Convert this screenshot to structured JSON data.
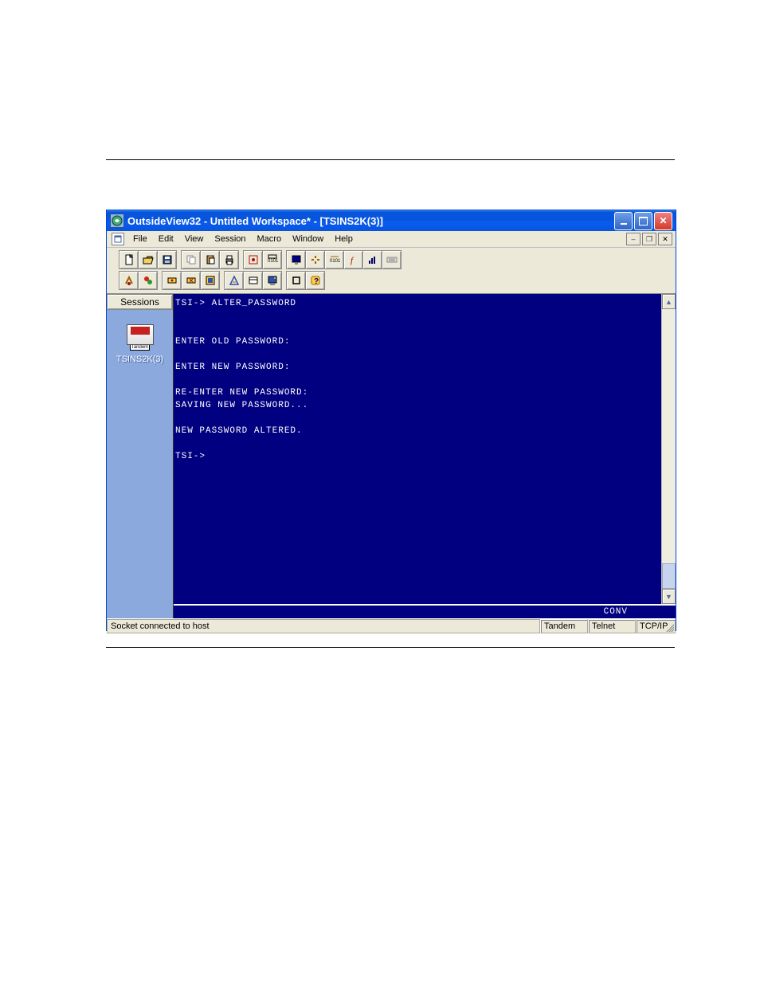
{
  "window": {
    "title": "OutsideView32 - Untitled Workspace* - [TSINS2K(3)]"
  },
  "menubar": [
    "File",
    "Edit",
    "View",
    "Session",
    "Macro",
    "Window",
    "Help"
  ],
  "sessions": {
    "header": "Sessions",
    "brand": "Tandem",
    "items": [
      "TSINS2K(3)"
    ]
  },
  "terminal": {
    "lines": [
      "TSI-> ALTER_PASSWORD",
      "",
      "",
      "ENTER OLD PASSWORD:",
      "",
      "ENTER NEW PASSWORD:",
      "",
      "RE-ENTER NEW PASSWORD:",
      "SAVING NEW PASSWORD...",
      "",
      "NEW PASSWORD ALTERED.",
      "",
      "TSI->"
    ],
    "mode": "CONV"
  },
  "statusbar": {
    "message": "Socket connected to host",
    "emulation": "Tandem",
    "protocol": "Telnet",
    "transport": "TCP/IP"
  }
}
